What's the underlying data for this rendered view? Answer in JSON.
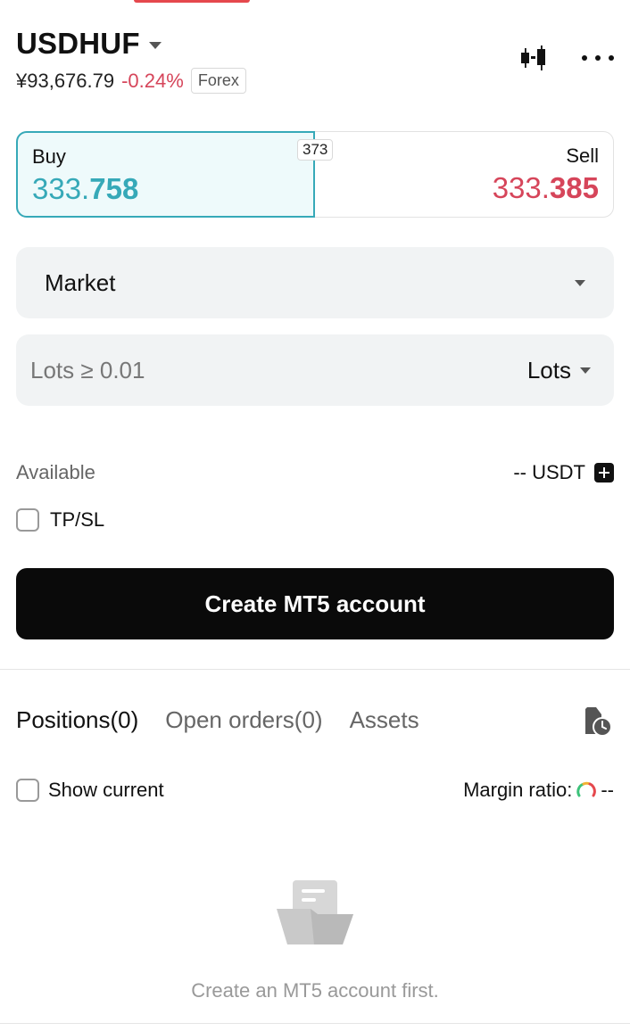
{
  "header": {
    "symbol": "USDHUF",
    "price_cny": "¥93,676.79",
    "change": "-0.24%",
    "badge": "Forex"
  },
  "icons": {
    "chart": "candlestick-icon",
    "more": "more-icon",
    "history": "history-icon",
    "gauge": "gauge-icon",
    "empty": "empty-folder-icon",
    "add": "plus-icon"
  },
  "trade": {
    "buy_label": "Buy",
    "buy_price_small": "333.",
    "buy_price_big": "758",
    "sell_label": "Sell",
    "sell_price_small": "333.",
    "sell_price_big": "385",
    "spread": "373"
  },
  "order_type": {
    "value": "Market"
  },
  "lots": {
    "placeholder": "Lots ≥ 0.01",
    "unit": "Lots"
  },
  "available": {
    "label": "Available",
    "value": "-- USDT"
  },
  "tpsl": {
    "label": "TP/SL",
    "checked": false
  },
  "create_button": {
    "label": "Create MT5 account"
  },
  "tabs": [
    {
      "label": "Positions(0)",
      "active": true
    },
    {
      "label": "Open orders(0)",
      "active": false
    },
    {
      "label": "Assets",
      "active": false
    }
  ],
  "filter": {
    "show_current_label": "Show current",
    "margin_label": "Margin ratio:",
    "margin_value": "--"
  },
  "empty_state": {
    "text": "Create an MT5 account first."
  },
  "colors": {
    "buy": "#36a9b8",
    "sell": "#d6455a",
    "button": "#0a0a0a"
  }
}
